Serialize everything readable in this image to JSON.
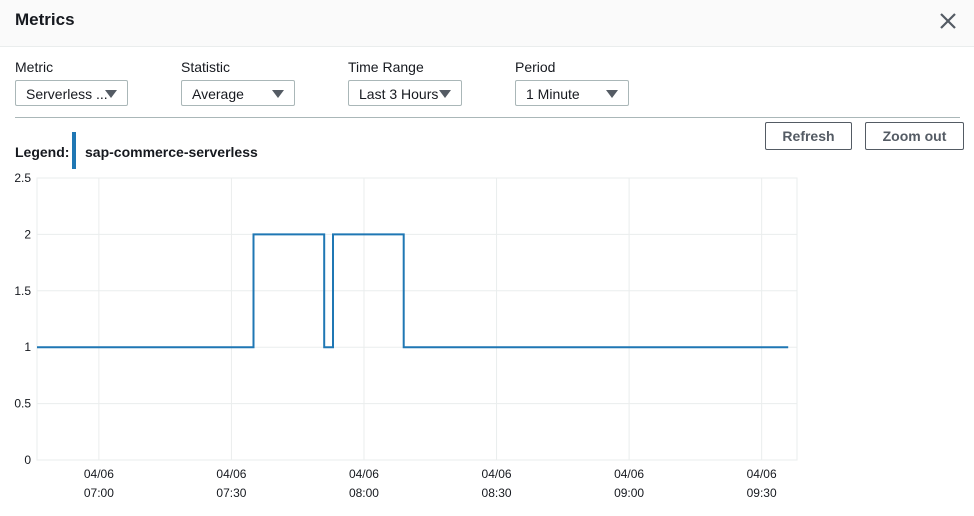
{
  "modal": {
    "title": "Metrics",
    "close_icon": "close-icon"
  },
  "controls": {
    "metric": {
      "label": "Metric",
      "value": "Serverless ..."
    },
    "statistic": {
      "label": "Statistic",
      "value": "Average"
    },
    "time_range": {
      "label": "Time Range",
      "value": "Last 3 Hours"
    },
    "period": {
      "label": "Period",
      "value": "1 Minute"
    }
  },
  "buttons": {
    "refresh": "Refresh",
    "zoom_out": "Zoom out"
  },
  "legend": {
    "label": "Legend:",
    "series_name": "sap-commerce-serverless",
    "color": "#1f77b4"
  },
  "chart_data": {
    "type": "line",
    "series": [
      {
        "name": "sap-commerce-serverless",
        "color": "#1f77b4",
        "step": true,
        "points": [
          [
            "06:46",
            1
          ],
          [
            "07:35",
            1
          ],
          [
            "07:35",
            2
          ],
          [
            "07:51",
            2
          ],
          [
            "07:51",
            1
          ],
          [
            "07:53",
            1
          ],
          [
            "07:53",
            2
          ],
          [
            "08:09",
            2
          ],
          [
            "08:09",
            1
          ],
          [
            "09:36",
            1
          ]
        ]
      }
    ],
    "x_range": [
      "06:46",
      "09:38"
    ],
    "ylim": [
      0,
      2.5
    ],
    "yticks": [
      "0",
      "0.5",
      "1",
      "1.5",
      "2",
      "2.5"
    ],
    "xticks": [
      {
        "time": "07:00",
        "date": "04/06",
        "label": "07:00"
      },
      {
        "time": "07:30",
        "date": "04/06",
        "label": "07:30"
      },
      {
        "time": "08:00",
        "date": "04/06",
        "label": "08:00"
      },
      {
        "time": "08:30",
        "date": "04/06",
        "label": "08:30"
      },
      {
        "time": "09:00",
        "date": "04/06",
        "label": "09:00"
      },
      {
        "time": "09:30",
        "date": "04/06",
        "label": "09:30"
      }
    ],
    "grid": true
  }
}
